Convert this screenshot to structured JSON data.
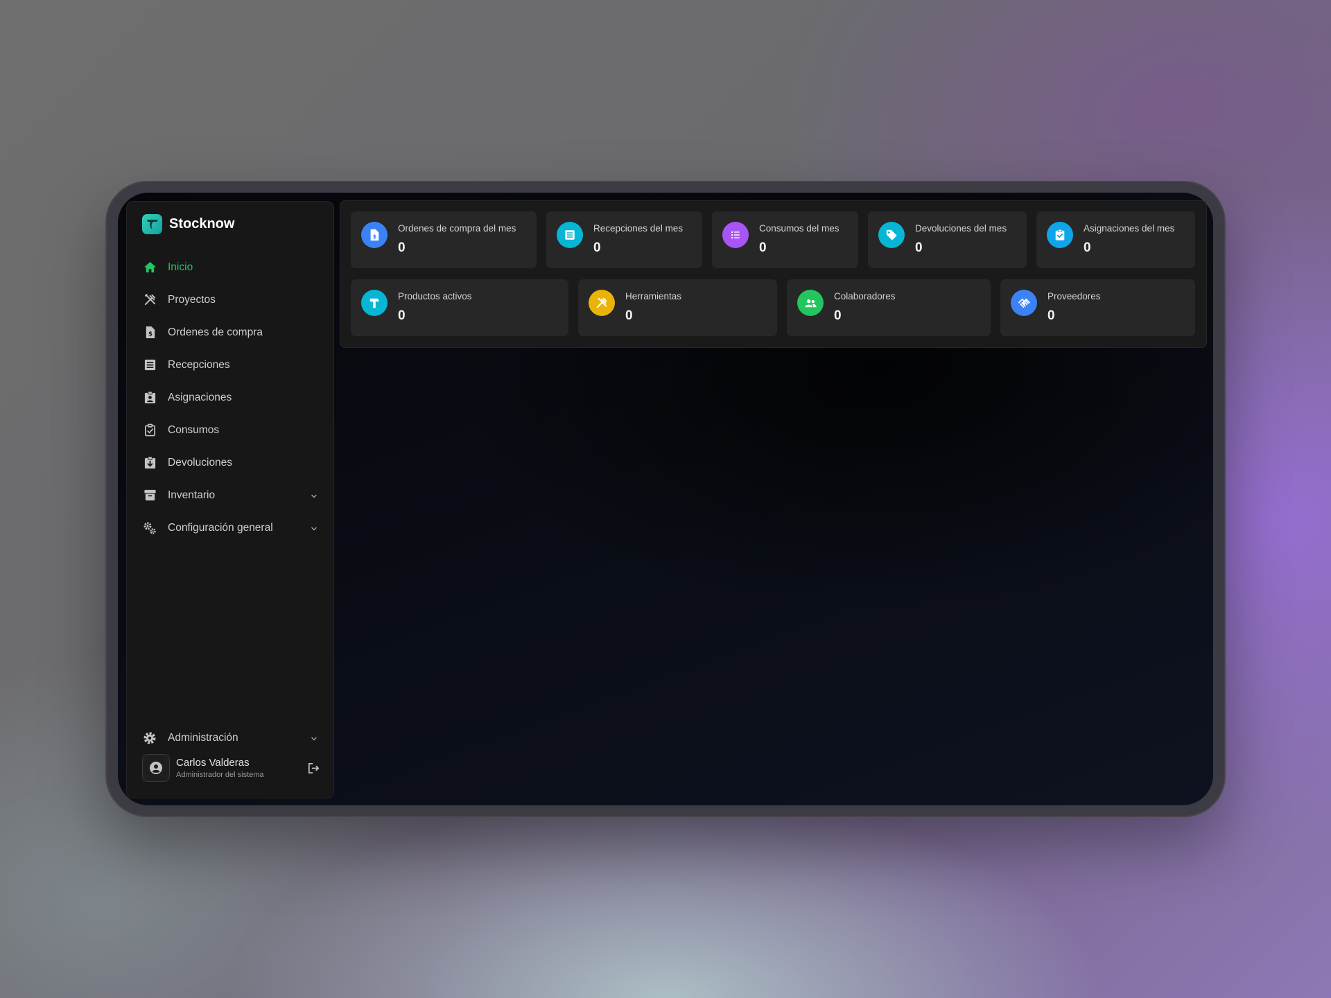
{
  "brand": {
    "name": "Stocknow"
  },
  "sidebar": {
    "items": [
      {
        "label": "Inicio",
        "icon": "home-icon",
        "active": true
      },
      {
        "label": "Proyectos",
        "icon": "tools-icon"
      },
      {
        "label": "Ordenes de compra",
        "icon": "invoice-icon"
      },
      {
        "label": "Recepciones",
        "icon": "list-icon"
      },
      {
        "label": "Asignaciones",
        "icon": "clipboard-user-icon"
      },
      {
        "label": "Consumos",
        "icon": "clipboard-check-icon"
      },
      {
        "label": "Devoluciones",
        "icon": "clipboard-return-icon"
      },
      {
        "label": "Inventario",
        "icon": "archive-icon",
        "expandable": true
      },
      {
        "label": "Configuración general",
        "icon": "gears-icon",
        "expandable": true
      }
    ],
    "admin": {
      "label": "Administración",
      "icon": "gear-icon"
    },
    "user": {
      "name": "Carlos Valderas",
      "role": "Administrador del sistema"
    }
  },
  "stats": {
    "row1": [
      {
        "label": "Ordenes de compra del mes",
        "value": "0",
        "icon": "invoice-icon",
        "color": "#3b82f6"
      },
      {
        "label": "Recepciones del mes",
        "value": "0",
        "icon": "list-icon",
        "color": "#06b6d4"
      },
      {
        "label": "Consumos del mes",
        "value": "0",
        "icon": "list-icon",
        "color": "#a855f7"
      },
      {
        "label": "Devoluciones del mes",
        "value": "0",
        "icon": "tag-icon",
        "color": "#06b6d4"
      },
      {
        "label": "Asignaciones del mes",
        "value": "0",
        "icon": "clipboard-check-icon",
        "color": "#0ea5e9"
      }
    ],
    "row2": [
      {
        "label": "Productos activos",
        "value": "0",
        "icon": "hammer-icon",
        "color": "#06b6d4"
      },
      {
        "label": "Herramientas",
        "value": "0",
        "icon": "tools-icon",
        "color": "#eab308"
      },
      {
        "label": "Colaboradores",
        "value": "0",
        "icon": "users-icon",
        "color": "#22c55e"
      },
      {
        "label": "Proveedores",
        "value": "0",
        "icon": "handshake-icon",
        "color": "#3b82f6"
      }
    ]
  }
}
